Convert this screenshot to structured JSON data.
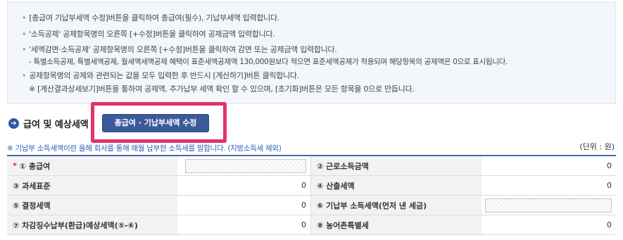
{
  "info": {
    "lines": [
      "[총급여 기납부세액 수정]버튼을 클릭하여 총급여(필수), 기납부세액 입력합니다.",
      "'소득공제' 공제항목명의 오른쪽 [+수정]버튼을 클릭하여 공제금액 입력합니다.",
      "'세액감면·소득공제' 공제항목명의 오른쪽 [+수정]버튼을 클릭하여 감면 또는 공제금액 입력합니다.",
      "- 특별소득공제, 특별세액공제, 월세액세액공제 혜택이 표준세액공제액 130,000원보다 적으면 표준세액공제가 적용되며 해당항목의 공제액은 0으로 표시됩니다.",
      "공제항목명의 공제와 관련되는 값을 모두 입력한 후 반드시 [계산하기]버튼 클릭합니다.",
      "※ [계산결과상세보기]버튼을 통하여 공제액, 추가납부 세액 확인 할 수 있으며, [초기화]버튼은 모든 항목을 0으로 만듭니다."
    ]
  },
  "section": {
    "title": "급여 및 예상세액",
    "edit_button": "총급여 · 기납부세액 수정"
  },
  "note": "※ 기납부 소득세액이란 올해 회사를 통해 매월 납부한 소득세를 말합니다. (지방소득세 제외)",
  "unit": "(단위 : 원)",
  "table": {
    "required_mark": "*",
    "rows": [
      {
        "left_label": "① 총급여",
        "left_value": "",
        "right_label": "② 근로소득금액",
        "right_value": "0"
      },
      {
        "left_label": "③ 과세표준",
        "left_value": "0",
        "right_label": "④ 산출세액",
        "right_value": "0"
      },
      {
        "left_label": "⑤ 결정세액",
        "left_value": "0",
        "right_label": "⑥ 기납부 소득세액(먼저 낸 세금)",
        "right_value": ""
      },
      {
        "left_label": "⑦ 차감징수납부(환급)예상세액(⑤-⑥)",
        "left_value": "0",
        "right_label": "⑧ 농어촌특별세",
        "right_value": "0"
      }
    ]
  }
}
